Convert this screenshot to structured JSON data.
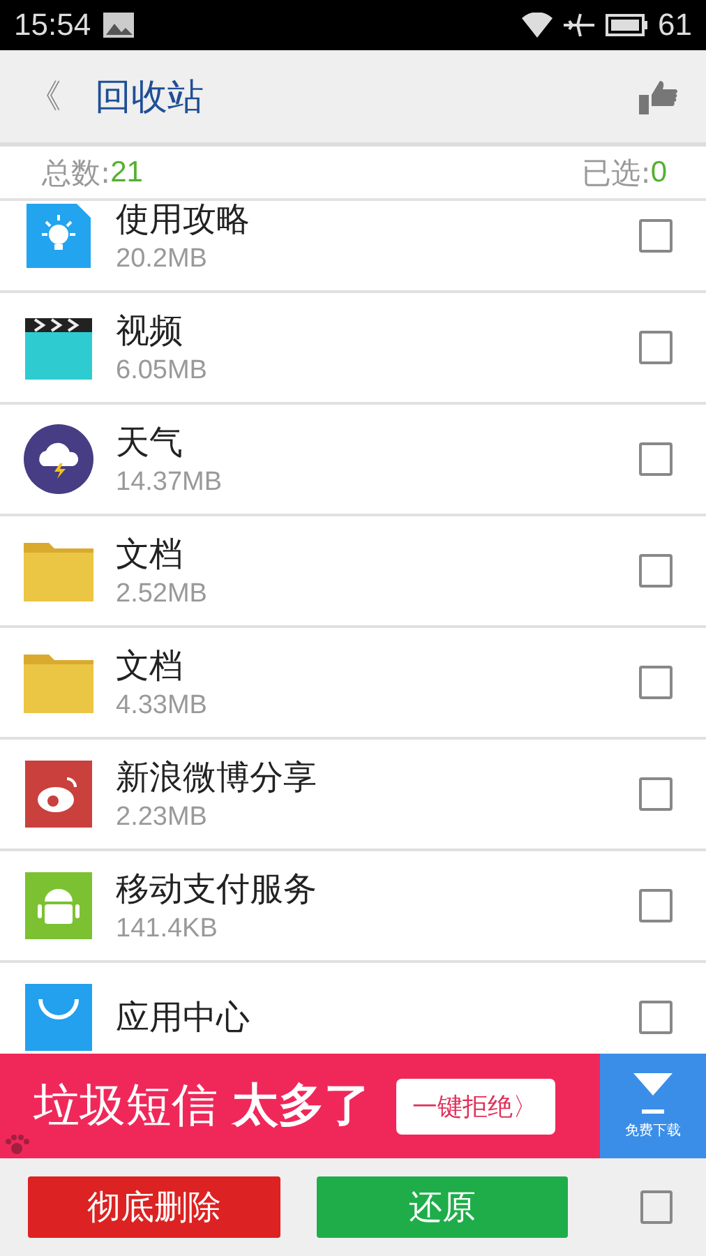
{
  "status_bar": {
    "time": "15:54",
    "battery": "61"
  },
  "header": {
    "back": "《",
    "title": "回收站"
  },
  "summary": {
    "total_label": "总数:",
    "total": "21",
    "selected_label": "已选:",
    "selected": "0"
  },
  "items": [
    {
      "kind": "guide",
      "name": "使用攻略",
      "size": "20.2MB",
      "checked": false
    },
    {
      "kind": "video",
      "name": "视频",
      "size": "6.05MB",
      "checked": false
    },
    {
      "kind": "weather",
      "name": "天气",
      "size": "14.37MB",
      "checked": false
    },
    {
      "kind": "folder",
      "name": "文档",
      "size": "2.52MB",
      "checked": false
    },
    {
      "kind": "folder",
      "name": "文档",
      "size": "4.33MB",
      "checked": false
    },
    {
      "kind": "weibo",
      "name": "新浪微博分享",
      "size": "2.23MB",
      "checked": false
    },
    {
      "kind": "android",
      "name": "移动支付服务",
      "size": "141.4KB",
      "checked": false
    },
    {
      "kind": "store",
      "name": "应用中心",
      "checked": false
    }
  ],
  "ad": {
    "headline": "垃圾短信 **太多了**",
    "button": "一键拒绝〉",
    "download": "免费下载"
  },
  "footer": {
    "delete": "彻底删除",
    "restore": "还原",
    "select_all": false
  }
}
